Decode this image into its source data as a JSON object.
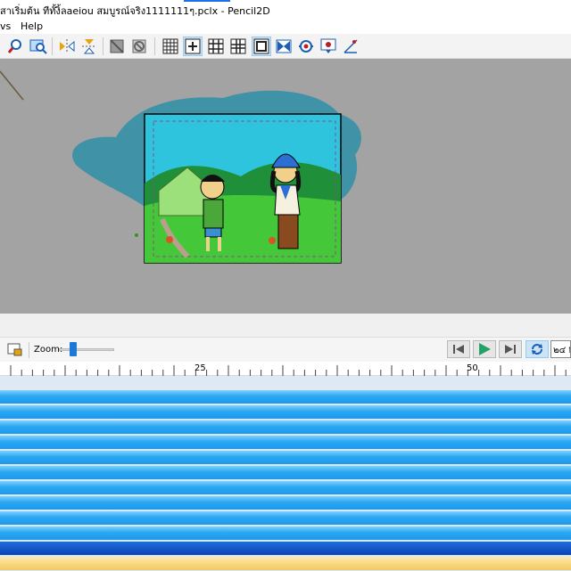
{
  "window": {
    "title": "สาเริ่มต้น ทีทั้งิ้ลaeiou สมบูรณ์จริง1111111ๆ.pclx - Pencil2D"
  },
  "menu": {
    "items": [
      "vs",
      "Help"
    ]
  },
  "toolbar": {
    "buttons": [
      "zoom-icon",
      "zoom-fit-icon",
      "flip-horizontal-icon",
      "flip-vertical-icon",
      "onion-prev-icon",
      "onion-next-icon",
      "grid-icon",
      "center-icon",
      "thirds-grid-icon",
      "golden-grid-icon",
      "safe-area-icon",
      "camera-motion-icon",
      "camera-path-icon",
      "overlay-settings-icon",
      "perspective-icon"
    ]
  },
  "canvas": {
    "background": "#a3a3a3",
    "frame_border": "#000000"
  },
  "timeline": {
    "zoom_label": "Zoom:",
    "zoom_level": 0.25,
    "fps_text": "๒๔ f",
    "ruler_ticks": [
      "25",
      "50"
    ],
    "track_count": 12,
    "accent": "#1e98ea"
  }
}
